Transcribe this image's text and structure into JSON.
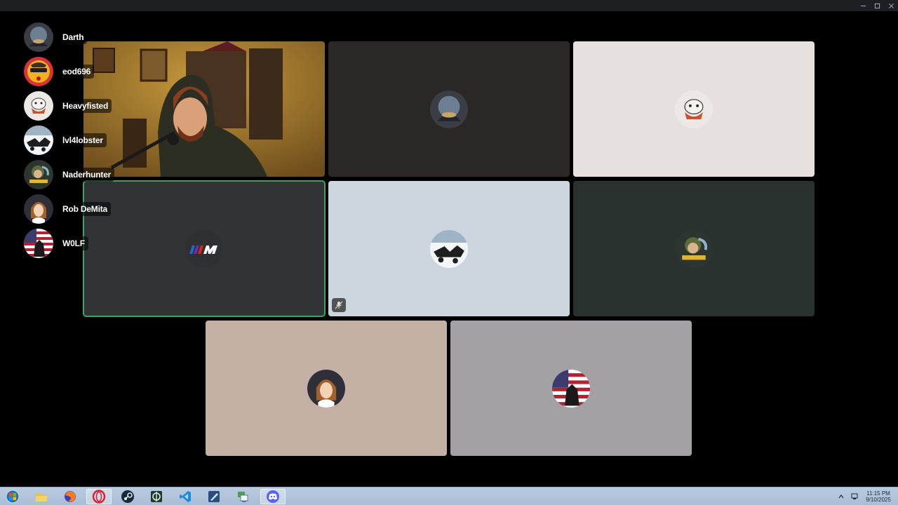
{
  "window": {
    "controls": [
      "minimize-icon",
      "maximize-icon",
      "close-icon"
    ]
  },
  "participants": [
    {
      "name": "Darth",
      "avatar": "darth-avatar"
    },
    {
      "name": "eod696",
      "avatar": "eod696-avatar"
    },
    {
      "name": "Heavyfisted",
      "avatar": "heavyfisted-avatar"
    },
    {
      "name": "lvl4lobster",
      "avatar": "lvl4lobster-avatar"
    },
    {
      "name": "Naderhunter",
      "avatar": "naderhunter-avatar"
    },
    {
      "name": "Rob DeMita",
      "avatar": "rob-demita-avatar"
    },
    {
      "name": "W0LF",
      "avatar": "w0lf-avatar"
    }
  ],
  "tiles": [
    {
      "type": "video",
      "avatar": "webcam-feed"
    },
    {
      "type": "avatar",
      "avatar": "darth-avatar",
      "bg": "#2b2727"
    },
    {
      "type": "avatar",
      "avatar": "heavyfisted-avatar",
      "bg": "#e6e1df"
    },
    {
      "type": "avatar",
      "avatar": "m-logo-avatar",
      "bg": "#323335",
      "speaking": true
    },
    {
      "type": "avatar",
      "avatar": "lvl4lobster-avatar",
      "bg": "#cdd6df",
      "muted": true
    },
    {
      "type": "avatar",
      "avatar": "naderhunter-avatar",
      "bg": "#2a322f"
    },
    {
      "type": "avatar",
      "avatar": "rob-demita-avatar",
      "bg": "#c5b0a6"
    },
    {
      "type": "avatar",
      "avatar": "w0lf-avatar",
      "bg": "#a4a1a5"
    }
  ],
  "taskbar": {
    "items": [
      "start-orb-icon",
      "file-explorer-icon",
      "firefox-icon",
      "opera-icon",
      "steam-icon",
      "game-launcher-icon",
      "vscode-icon",
      "editor-icon",
      "network-app-icon",
      "discord-icon"
    ],
    "active_item": "discord-icon",
    "clock_time": "11:15 PM",
    "clock_date": "9/10/2025"
  },
  "colors": {
    "speaking_outline": "#3ba55c",
    "discord_blurple": "#5865f2",
    "taskbar": "#b1c4db"
  }
}
